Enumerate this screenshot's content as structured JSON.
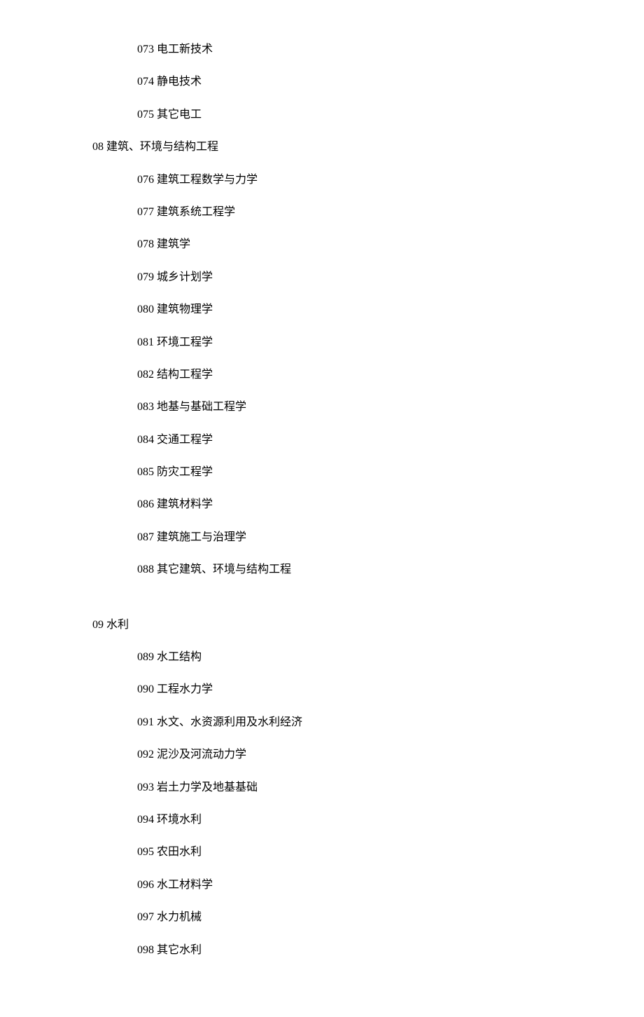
{
  "leading_items": [
    "073 电工新技术",
    "074 静电技术",
    "075 其它电工"
  ],
  "sections": [
    {
      "header": "08 建筑、环境与结构工程",
      "items": [
        "076 建筑工程数学与力学",
        "077 建筑系统工程学",
        "078 建筑学",
        "079 城乡计划学",
        "080 建筑物理学",
        "081 环境工程学",
        "082 结构工程学",
        "083 地基与基础工程学",
        "084 交通工程学",
        "085 防灾工程学",
        "086 建筑材料学",
        "087 建筑施工与治理学",
        "088 其它建筑、环境与结构工程"
      ],
      "gap_before": false
    },
    {
      "header": "09 水利",
      "items": [
        "089 水工结构",
        "090 工程水力学",
        "091 水文、水资源利用及水利经济",
        "092 泥沙及河流动力学",
        "093 岩土力学及地基基础",
        "094 环境水利",
        "095 农田水利",
        "096 水工材料学",
        "097 水力机械",
        "098 其它水利"
      ],
      "gap_before": true
    }
  ]
}
